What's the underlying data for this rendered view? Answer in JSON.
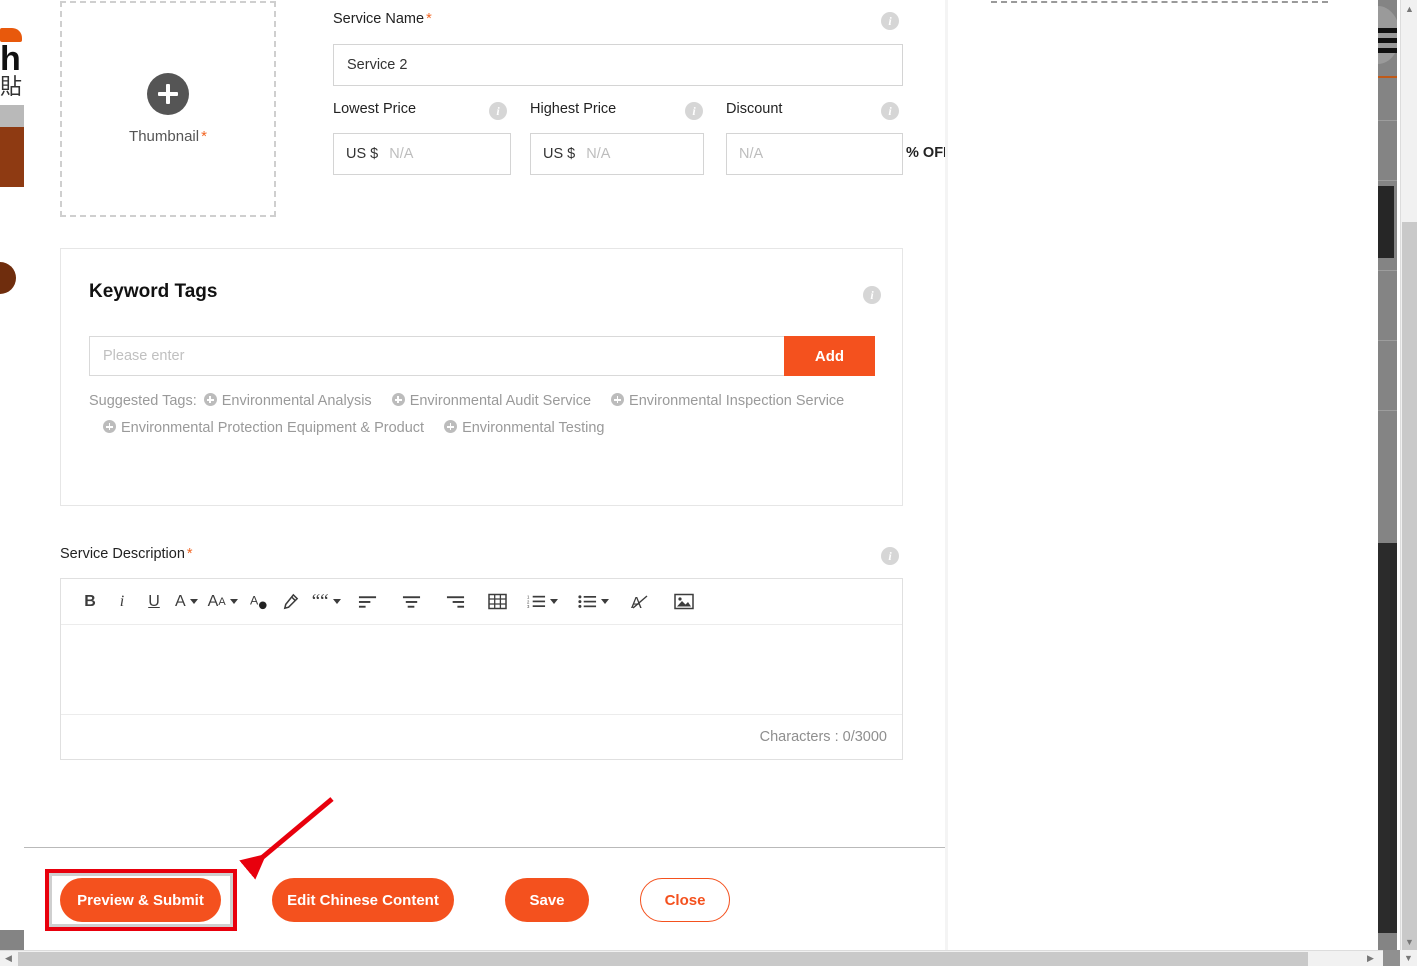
{
  "modal": {
    "thumbnail": {
      "label": "Thumbnail",
      "required_mark": "*",
      "icon": "plus-circle-icon"
    },
    "service_name": {
      "label": "Service Name",
      "required_mark": "*",
      "value": "Service 2",
      "placeholder": "",
      "info_icon": "info-icon"
    },
    "lowest_price": {
      "label": "Lowest Price",
      "currency": "US $",
      "value": "",
      "placeholder": "N/A",
      "info_icon": "info-icon"
    },
    "highest_price": {
      "label": "Highest Price",
      "currency": "US $",
      "value": "",
      "placeholder": "N/A",
      "info_icon": "info-icon"
    },
    "discount": {
      "label": "Discount",
      "value": "",
      "placeholder": "N/A",
      "suffix": "% OFF",
      "info_icon": "info-icon"
    },
    "keyword_tags": {
      "title": "Keyword Tags",
      "info_icon": "info-icon",
      "input_placeholder": "Please enter",
      "input_value": "",
      "add_label": "Add",
      "suggested_label": "Suggested Tags:",
      "suggested": [
        "Environmental Analysis",
        "Environmental Audit Service",
        "Environmental Inspection Service",
        "Environmental Protection Equipment & Product",
        "Environmental Testing"
      ]
    },
    "service_description": {
      "label": "Service Description",
      "required_mark": "*",
      "info_icon": "info-icon",
      "content": "",
      "counter": "Characters : 0/3000",
      "toolbar": [
        {
          "name": "bold-icon",
          "glyph": "B"
        },
        {
          "name": "italic-icon",
          "glyph": "i"
        },
        {
          "name": "underline-icon",
          "glyph": "U"
        },
        {
          "name": "font-color-icon",
          "glyph": "A"
        },
        {
          "name": "font-size-icon",
          "glyph": "AA"
        },
        {
          "name": "text-fill-icon",
          "glyph": "A"
        },
        {
          "name": "highlighter-icon",
          "glyph": "marker"
        },
        {
          "name": "blockquote-icon",
          "glyph": "““"
        },
        {
          "name": "align-left-icon",
          "glyph": "align-left"
        },
        {
          "name": "align-center-icon",
          "glyph": "align-center"
        },
        {
          "name": "align-right-icon",
          "glyph": "align-right"
        },
        {
          "name": "table-icon",
          "glyph": "table"
        },
        {
          "name": "ordered-list-icon",
          "glyph": "ol"
        },
        {
          "name": "unordered-list-icon",
          "glyph": "ul"
        },
        {
          "name": "clear-format-icon",
          "glyph": "A-strike"
        },
        {
          "name": "insert-image-icon",
          "glyph": "image"
        }
      ]
    },
    "footer": {
      "preview_submit": "Preview & Submit",
      "edit_chinese": "Edit Chinese Content",
      "save": "Save",
      "close": "Close"
    }
  },
  "annotation": {
    "highlight_target": "preview-submit-button",
    "arrow_color": "#e8000d",
    "box_color": "#e8000d"
  },
  "colors": {
    "accent": "#f4511e",
    "annotation": "#e8000d",
    "required": "#f26522",
    "muted_text": "#9a9a9a"
  },
  "scrollbars": {
    "vertical_up": "▲",
    "vertical_down": "▼",
    "horizontal_left": "◀",
    "horizontal_right": "▶",
    "corner": "▼"
  },
  "background_page": {
    "left_text_h": "h",
    "left_text_cn": "貼"
  }
}
